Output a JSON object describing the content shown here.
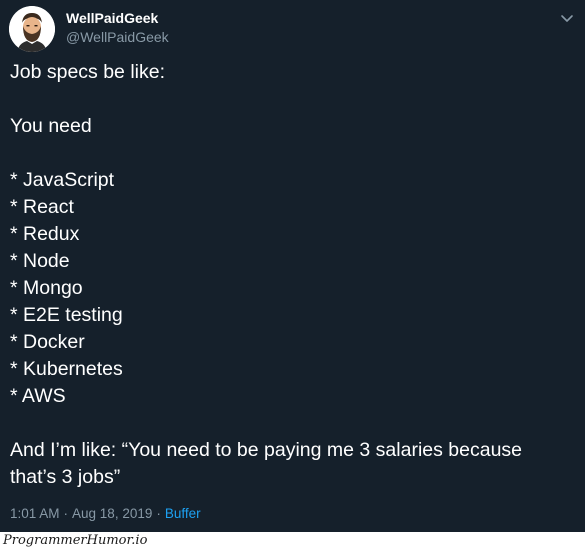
{
  "author": {
    "display_name": "WellPaidGeek",
    "handle": "@WellPaidGeek",
    "avatar_icon": "bearded-man-avatar-icon"
  },
  "tweet": {
    "lines": [
      "Job specs be like:",
      "",
      "You need",
      "",
      "* JavaScript",
      "* React",
      "* Redux",
      "* Node",
      "* Mongo",
      "* E2E testing",
      "* Docker",
      "* Kubernetes",
      "* AWS",
      "",
      "And I’m like: “You need to be paying me 3 salaries because that’s 3 jobs”"
    ],
    "time": "1:01 AM",
    "separator": "·",
    "date": "Aug 18, 2019",
    "source": "Buffer"
  },
  "watermark": {
    "text": "ProgrammerHumor.io"
  },
  "colors": {
    "background": "#15202b",
    "muted_text": "#8899a6",
    "link": "#1da1f2"
  },
  "menu_icon": "chevron-down-icon"
}
